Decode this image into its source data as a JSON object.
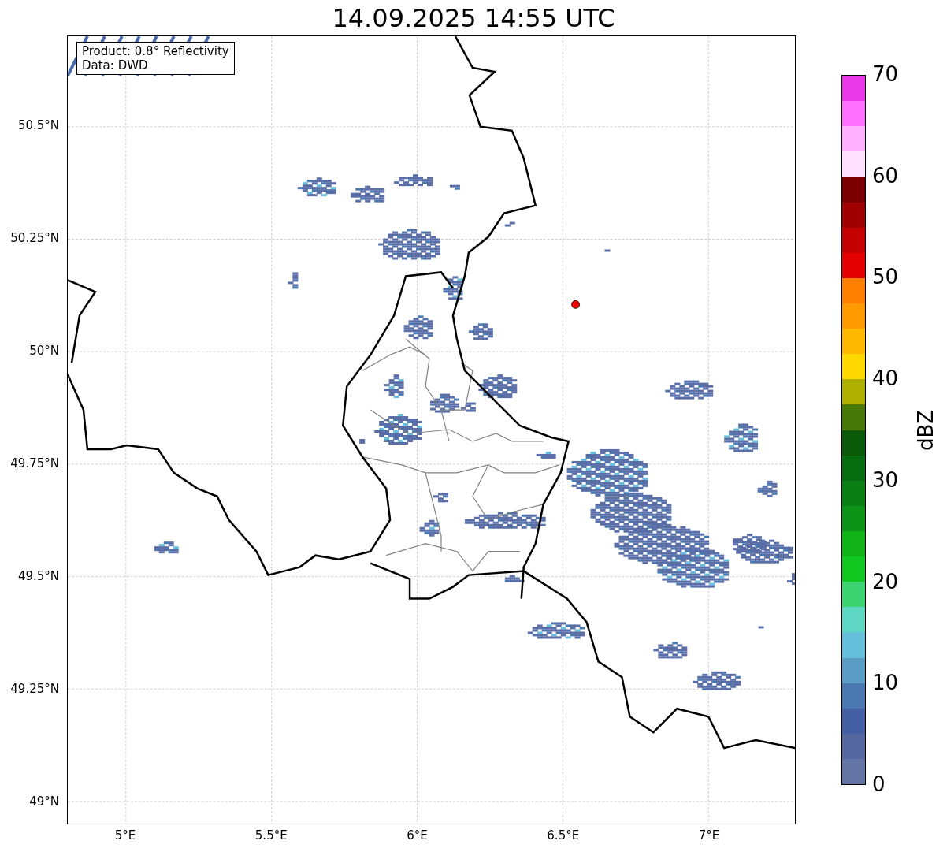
{
  "title": "14.09.2025 14:55 UTC",
  "info_box": {
    "lines": [
      "Product: 0.8° Reflectivity",
      "Data: DWD"
    ]
  },
  "map": {
    "lat_ticks": [
      "50.5°N",
      "50.25°N",
      "50°N",
      "49.75°N",
      "49.5°N",
      "49.25°N",
      "49°N"
    ],
    "lon_ticks": [
      "5°E",
      "5.5°E",
      "6°E",
      "6.5°E",
      "7°E"
    ]
  },
  "colorbar": {
    "label": "dBZ",
    "ticks": [
      "70",
      "60",
      "50",
      "40",
      "30",
      "20",
      "10",
      "0"
    ],
    "segments": [
      {
        "color": "#e838e8"
      },
      {
        "color": "#ff70ff"
      },
      {
        "color": "#ffb0ff"
      },
      {
        "color": "#ffe0ff"
      },
      {
        "color": "#7a0000"
      },
      {
        "color": "#a00000"
      },
      {
        "color": "#c40000"
      },
      {
        "color": "#e40000"
      },
      {
        "color": "#ff8000"
      },
      {
        "color": "#ff9a00"
      },
      {
        "color": "#ffb800"
      },
      {
        "color": "#ffd800"
      },
      {
        "color": "#b0b000"
      },
      {
        "color": "#487808"
      },
      {
        "color": "#0a5a0a"
      },
      {
        "color": "#086c10"
      },
      {
        "color": "#0a8014"
      },
      {
        "color": "#0c9418"
      },
      {
        "color": "#10b418"
      },
      {
        "color": "#10c820"
      },
      {
        "color": "#3cd470"
      },
      {
        "color": "#5ed8c4"
      },
      {
        "color": "#66c0dc"
      },
      {
        "color": "#5a9cc4"
      },
      {
        "color": "#4a78b0"
      },
      {
        "color": "#4460a4"
      },
      {
        "color": "#54689f"
      },
      {
        "color": "#6474a4"
      }
    ]
  }
}
